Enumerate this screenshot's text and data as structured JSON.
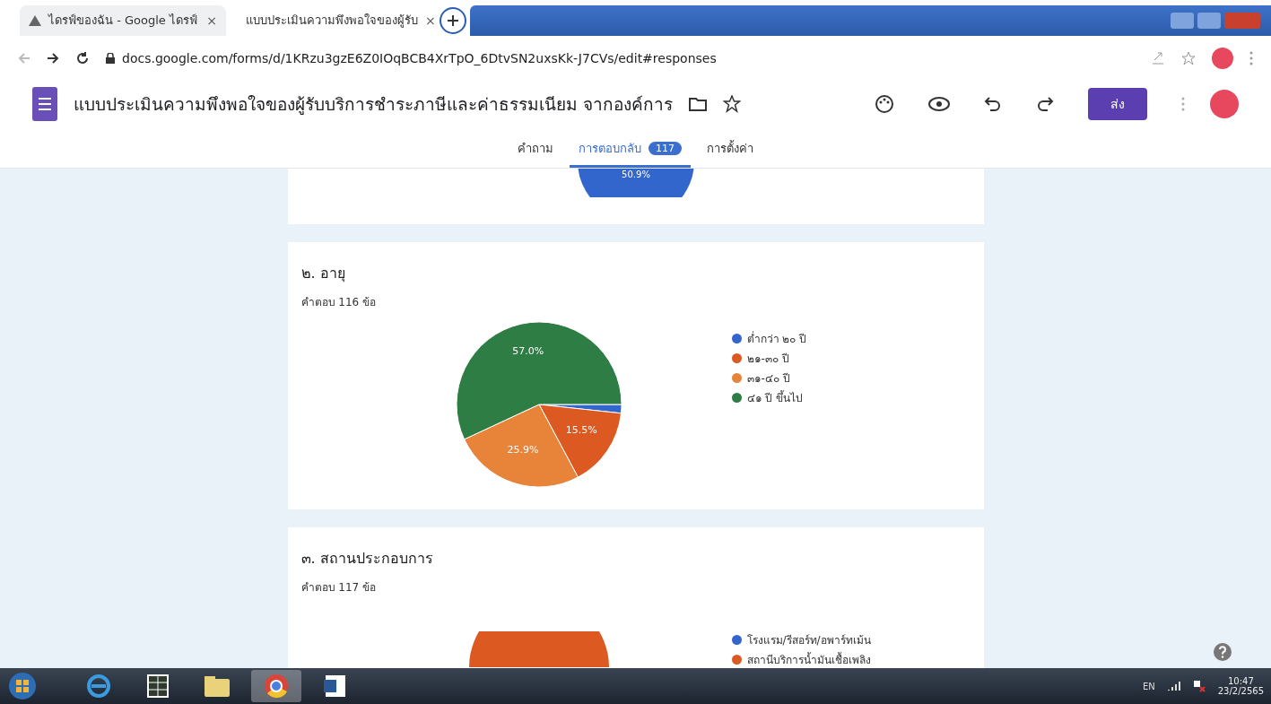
{
  "browser": {
    "tabs": [
      {
        "title": "ไดรฟ์ของฉัน - Google ไดรฟ์",
        "kind": "drive",
        "selected": false,
        "close": "×"
      },
      {
        "title": "แบบประเมินความพึงพอใจของผู้รับ",
        "kind": "forms",
        "selected": true,
        "close": "×"
      }
    ],
    "url": "docs.google.com/forms/d/1KRzu3gzE6Z0IOqBCB4XrTpO_6DtvSN2uxsKk-J7CVs/edit#responses"
  },
  "form": {
    "title": "แบบประเมินความพึงพอใจของผู้รับบริการชำระภาษีและค่าธรรมเนียม จากองค์การ",
    "send_button": "ส่ง",
    "tabs": [
      {
        "label": "คำถาม",
        "selected": false
      },
      {
        "label": "การตอบกลับ",
        "selected": true,
        "badge": "117"
      },
      {
        "label": "การตั้งค่า",
        "selected": false
      }
    ]
  },
  "questions": [
    {
      "kind": "partial",
      "chart_label": "50.9%"
    },
    {
      "kind": "chart",
      "title": "๒. อายุ",
      "count": "คำตอบ 116 ข้อ",
      "chart_data": {
        "type": "pie",
        "legend": "right",
        "categories": [
          "ต่ำกว่า ๒๐ ปี",
          "๒๑-๓๐ ปี",
          "๓๑-๔๐ ปี",
          "๔๑ ปี ขึ้นไป"
        ],
        "values": [
          1.7,
          15.5,
          25.9,
          57.0
        ],
        "data_labels": true,
        "value_labels": [
          null,
          "15.5%",
          "25.9%",
          "57.0%"
        ]
      }
    },
    {
      "kind": "cut",
      "title": "๓. สถานประกอบการ",
      "count": "คำตอบ 117 ข้อ",
      "legend": [
        {
          "label": "โรงแรม/รีสอร์ท/อพาร์ทเม้น",
          "color": "#3366cc"
        },
        {
          "label": "สถานีบริการน้ำมันเชื้อเพลิง",
          "color": "#dc5a22"
        }
      ]
    }
  ],
  "taskbar": {
    "apps": [
      {
        "kind": "ie",
        "selected": false
      },
      {
        "kind": "sheet",
        "selected": false
      },
      {
        "kind": "folder",
        "selected": false
      },
      {
        "kind": "chrome",
        "selected": true
      },
      {
        "kind": "word",
        "selected": false
      }
    ],
    "language": "EN",
    "time": "10:47",
    "date": "23/2/2565"
  }
}
